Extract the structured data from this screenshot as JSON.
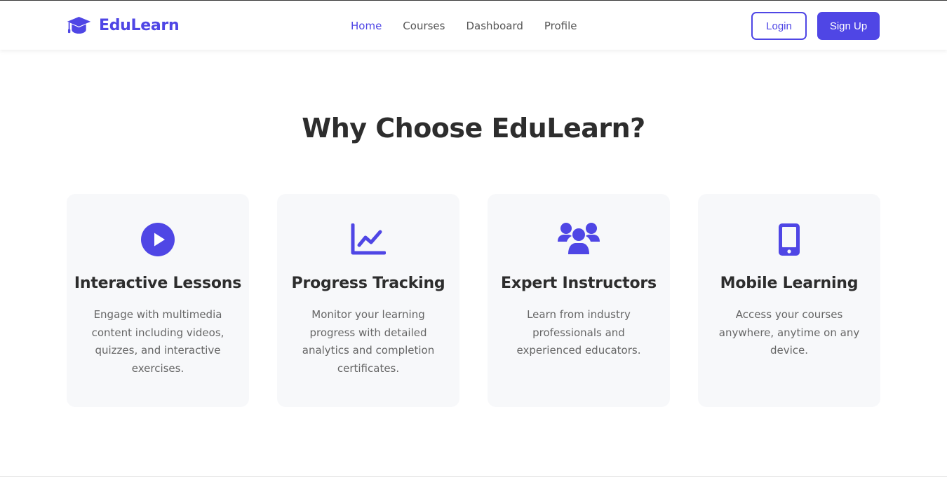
{
  "header": {
    "brand": {
      "name": "EduLearn",
      "icon": "graduation-cap-icon"
    },
    "nav": [
      {
        "label": "Home",
        "active": true
      },
      {
        "label": "Courses",
        "active": false
      },
      {
        "label": "Dashboard",
        "active": false
      },
      {
        "label": "Profile",
        "active": false
      }
    ],
    "login_label": "Login",
    "signup_label": "Sign Up"
  },
  "features": {
    "title": "Why Choose EduLearn?",
    "cards": [
      {
        "icon": "play-circle-icon",
        "title": "Interactive Lessons",
        "description": "Engage with multimedia content including videos, quizzes, and interactive exercises."
      },
      {
        "icon": "line-chart-icon",
        "title": "Progress Tracking",
        "description": "Monitor your learning progress with detailed analytics and completion certificates."
      },
      {
        "icon": "users-icon",
        "title": "Expert Instructors",
        "description": "Learn from industry professionals and experienced educators."
      },
      {
        "icon": "mobile-phone-icon",
        "title": "Mobile Learning",
        "description": "Access your courses anywhere, anytime on any device."
      }
    ]
  },
  "theme": {
    "accent": "#4f46e5",
    "card_background": "#f7f8fa",
    "heading": "#2d2d2d",
    "body_text": "#666666"
  }
}
